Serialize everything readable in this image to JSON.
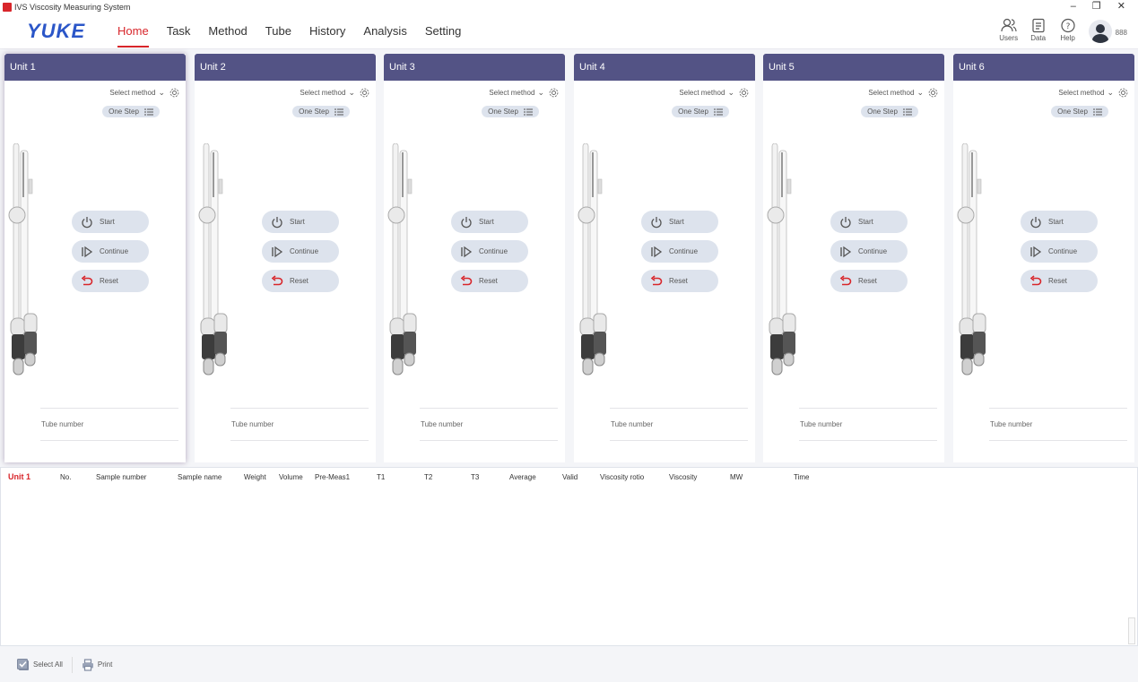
{
  "window": {
    "title": "IVS Viscosity Measuring System",
    "minimize": "–",
    "restore": "❐",
    "close": "✕"
  },
  "brand": {
    "logo": "YUKE",
    "accent": "#d8262b",
    "header_color": "#535385",
    "logo_color": "#2b56c8"
  },
  "nav": [
    {
      "label": "Home",
      "active": true
    },
    {
      "label": "Task"
    },
    {
      "label": "Method"
    },
    {
      "label": "Tube"
    },
    {
      "label": "History"
    },
    {
      "label": "Analysis"
    },
    {
      "label": "Setting"
    }
  ],
  "tools": [
    {
      "label": "Users",
      "icon": "users-icon"
    },
    {
      "label": "Data",
      "icon": "data-icon"
    },
    {
      "label": "Help",
      "icon": "help-icon"
    }
  ],
  "user": {
    "name": "888"
  },
  "units": [
    {
      "name": "Unit 1"
    },
    {
      "name": "Unit 2"
    },
    {
      "name": "Unit 3"
    },
    {
      "name": "Unit 4"
    },
    {
      "name": "Unit 5"
    },
    {
      "name": "Unit 6"
    }
  ],
  "unit_controls": {
    "select_method": "Select method",
    "step_mode": "One Step",
    "start": "Start",
    "continue": "Continue",
    "reset": "Reset",
    "tube_number": "Tube number"
  },
  "results": {
    "unit": "Unit 1",
    "columns": [
      "No.",
      "Sample number",
      "Sample name",
      "Weight",
      "Volume",
      "Pre-Meas1",
      "T1",
      "T2",
      "T3",
      "Average",
      "Valid",
      "Viscosity rotio",
      "Viscosity",
      "MW",
      "Time"
    ]
  },
  "footer": {
    "select_all": "Select All",
    "print": "Print"
  }
}
